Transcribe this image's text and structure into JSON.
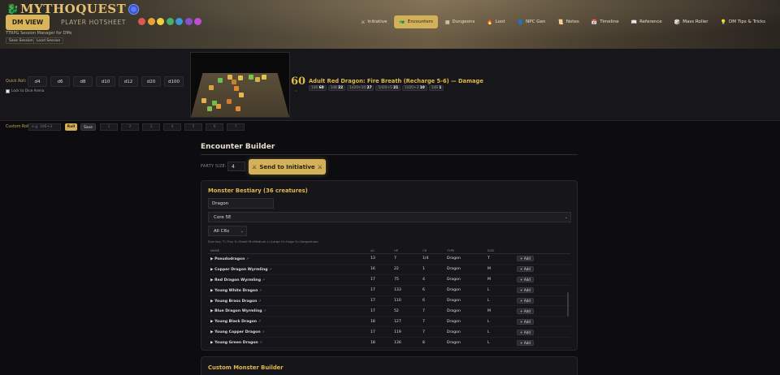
{
  "header": {
    "app_name": "MYTHOQUEST",
    "tagline": "TTRPG Session Manager for DMs",
    "session_buttons": [
      "Save Session",
      "Load Session"
    ],
    "view_dm": "DM VIEW",
    "view_player": "PLAYER HOTSHEET",
    "theme_colors": [
      "#e0574f",
      "#e8a23a",
      "#f0d040",
      "#46b36a",
      "#3a9ad8",
      "#8a4fd0",
      "#c04fd0"
    ],
    "nav": [
      {
        "label": "Initiative",
        "icon": "swords-icon"
      },
      {
        "label": "Encounters",
        "icon": "creature-icon",
        "active": true
      },
      {
        "label": "Dungeons",
        "icon": "map-icon"
      },
      {
        "label": "Loot",
        "icon": "fire-icon"
      },
      {
        "label": "NPC Gen",
        "icon": "person-icon"
      },
      {
        "label": "Notes",
        "icon": "scroll-icon"
      },
      {
        "label": "Timeline",
        "icon": "calendar-icon"
      },
      {
        "label": "Reference",
        "icon": "book-icon"
      },
      {
        "label": "Mass Roller",
        "icon": "dice-icon"
      },
      {
        "label": "DM Tips & Tricks",
        "icon": "lightbulb-icon"
      }
    ]
  },
  "dice": {
    "quick_roll_label": "Quick Roll:",
    "dice_buttons": [
      "d4",
      "d6",
      "d8",
      "d10",
      "d12",
      "d20",
      "d100"
    ],
    "lock_label": "Lock to Dice Arena",
    "total": "60",
    "total_sub": "=",
    "result_title": "Adult Red Dragon: Fire Breath (Recharge 5-6) — Damage",
    "rolls": [
      {
        "die": "1d6",
        "val": "60"
      },
      {
        "die": "1d8",
        "val": "22"
      },
      {
        "die": "1d20+10",
        "val": "27"
      },
      {
        "die": "1d20+5",
        "val": "21"
      },
      {
        "die": "1d20+3",
        "val": "10"
      },
      {
        "die": "1d8",
        "val": "1"
      }
    ]
  },
  "custom_roll": {
    "label": "Custom Roll:",
    "placeholder": "e.g. 3d6+3",
    "roll_label": "Roll",
    "save_label": "Save",
    "slots": [
      "1",
      "2",
      "3",
      "4",
      "5",
      "6",
      "7"
    ]
  },
  "encounter": {
    "title": "Encounter Builder",
    "party_size_label": "PARTY SIZE:",
    "party_size": "4",
    "send_label": "Send to Initiative",
    "bestiary_title": "Monster Bestiary (36 creatures)",
    "search_value": "Dragon",
    "source_value": "Core 5E",
    "cr_value": "All CRs",
    "size_key": "Size key: T=Tiny S=Small M=Medium L=Large H=Huge G=Gargantuan",
    "columns": [
      "NAME",
      "AC",
      "HP",
      "CR",
      "TYPE",
      "SIZE"
    ],
    "add_label": "+ Add",
    "rows": [
      {
        "name": "Pseudodragon",
        "ac": "13",
        "hp": "7",
        "cr": "1/4",
        "type": "Dragon",
        "size": "T"
      },
      {
        "name": "Copper Dragon Wyrmling",
        "ac": "16",
        "hp": "22",
        "cr": "1",
        "type": "Dragon",
        "size": "M"
      },
      {
        "name": "Red Dragon Wyrmling",
        "ac": "17",
        "hp": "75",
        "cr": "4",
        "type": "Dragon",
        "size": "M"
      },
      {
        "name": "Young White Dragon",
        "ac": "17",
        "hp": "133",
        "cr": "6",
        "type": "Dragon",
        "size": "L"
      },
      {
        "name": "Young Brass Dragon",
        "ac": "17",
        "hp": "110",
        "cr": "6",
        "type": "Dragon",
        "size": "L"
      },
      {
        "name": "Blue Dragon Wyrmling",
        "ac": "17",
        "hp": "52",
        "cr": "7",
        "type": "Dragon",
        "size": "M"
      },
      {
        "name": "Young Black Dragon",
        "ac": "18",
        "hp": "127",
        "cr": "7",
        "type": "Dragon",
        "size": "L"
      },
      {
        "name": "Young Copper Dragon",
        "ac": "17",
        "hp": "119",
        "cr": "7",
        "type": "Dragon",
        "size": "L"
      },
      {
        "name": "Young Green Dragon",
        "ac": "18",
        "hp": "136",
        "cr": "8",
        "type": "Dragon",
        "size": "L"
      }
    ],
    "custom_builder_title": "Custom Monster Builder"
  }
}
